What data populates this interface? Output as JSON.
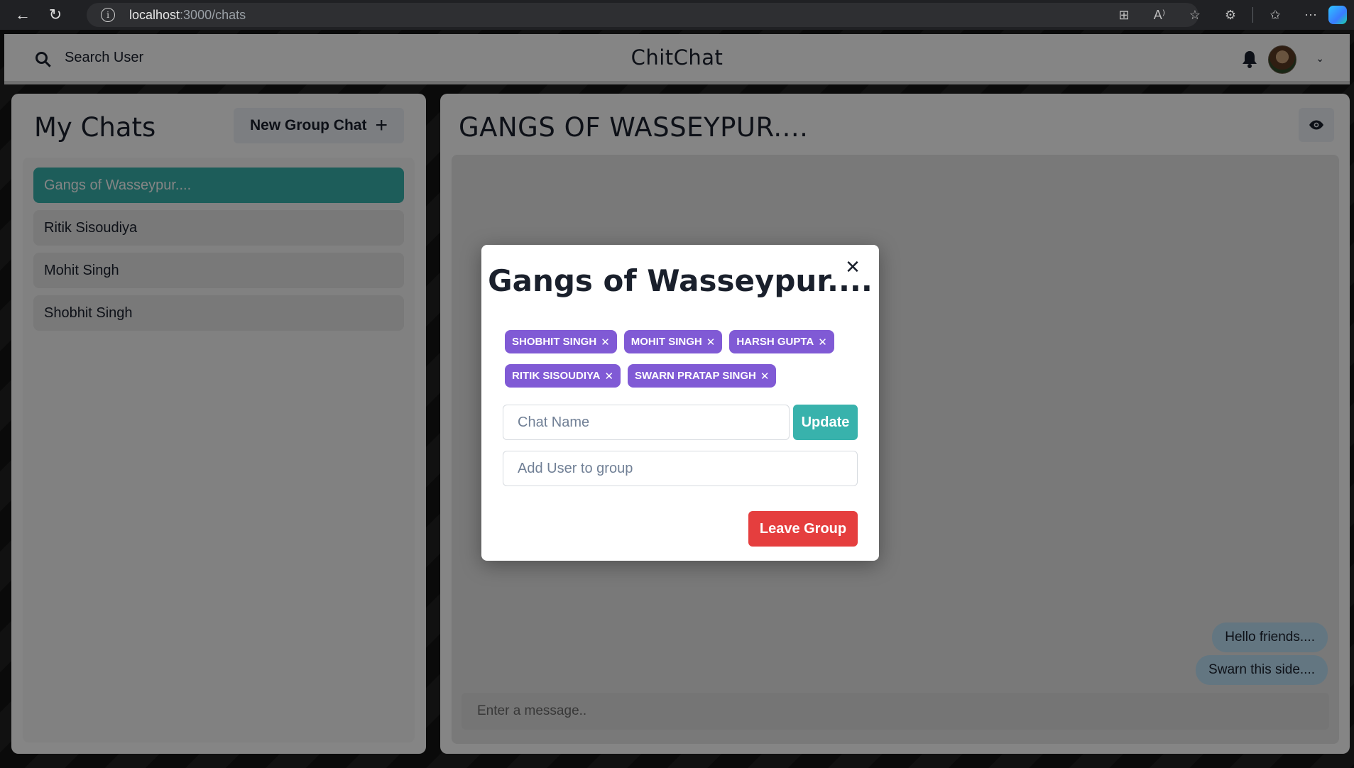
{
  "browser": {
    "url_host": "localhost",
    "url_path": ":3000/chats"
  },
  "header": {
    "search_label": "Search User",
    "app_title": "ChitChat"
  },
  "sidebar": {
    "title": "My Chats",
    "new_group_label": "New Group Chat",
    "chats": [
      {
        "name": "Gangs of Wasseypur....",
        "active": true
      },
      {
        "name": "Ritik Sisoudiya",
        "active": false
      },
      {
        "name": "Mohit Singh",
        "active": false
      },
      {
        "name": "Shobhit Singh",
        "active": false
      }
    ]
  },
  "chat": {
    "title": "GANGS OF WASSEYPUR....",
    "messages": [
      {
        "text": "Hello friends...."
      },
      {
        "text": "Swarn this side...."
      }
    ],
    "input_placeholder": "Enter a message.."
  },
  "modal": {
    "title": "Gangs of Wasseypur....",
    "members": [
      "SHOBHIT SINGH",
      "MOHIT SINGH",
      "HARSH GUPTA",
      "RITIK SISOUDIYA",
      "SWARN PRATAP SINGH"
    ],
    "chat_name_placeholder": "Chat Name",
    "update_label": "Update",
    "add_user_placeholder": "Add User to group",
    "leave_label": "Leave Group"
  },
  "colors": {
    "accent_teal": "#38b2ac",
    "badge_purple": "#805ad5",
    "danger_red": "#e53e3e",
    "bubble_blue": "#bee3f8"
  }
}
